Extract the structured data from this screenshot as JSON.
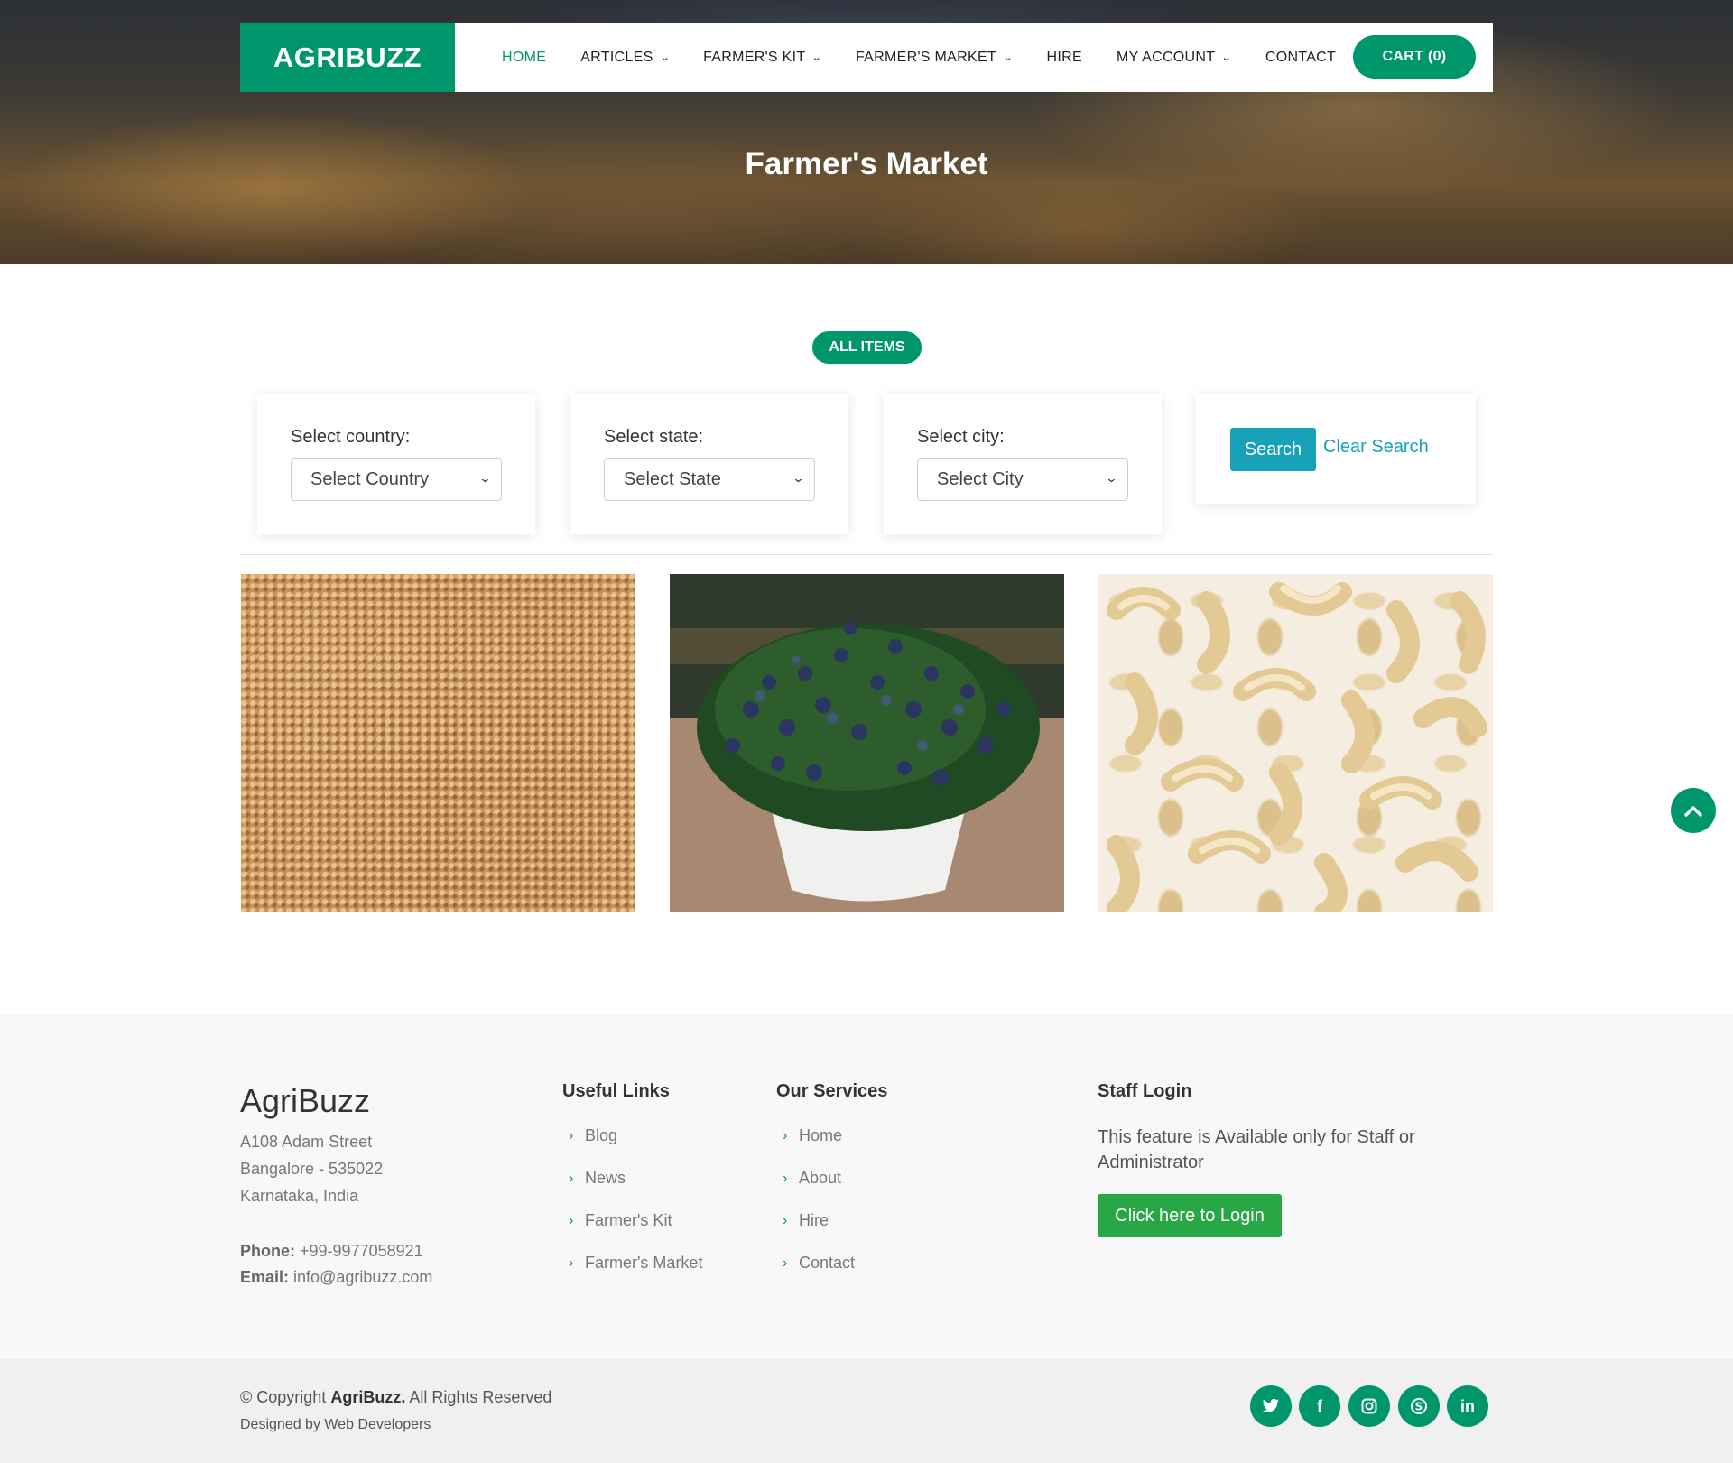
{
  "header": {
    "logo": "AGRIBUZZ",
    "nav": [
      {
        "label": "HOME",
        "active": true
      },
      {
        "label": "ARTICLES",
        "dropdown": true
      },
      {
        "label": "FARMER'S KIT",
        "dropdown": true
      },
      {
        "label": "FARMER'S MARKET",
        "dropdown": true
      },
      {
        "label": "HIRE"
      },
      {
        "label": "MY ACCOUNT",
        "dropdown": true
      },
      {
        "label": "CONTACT"
      }
    ],
    "cart_label": "CART (0)"
  },
  "hero": {
    "title": "Farmer's Market"
  },
  "filters": {
    "all_items": "ALL ITEMS",
    "country_label": "Select country:",
    "country_value": "Select Country",
    "state_label": "Select state:",
    "state_value": "Select State",
    "city_label": "Select city:",
    "city_value": "Select City",
    "search_label": "Search",
    "clear_label": "Clear Search"
  },
  "products": [
    {
      "name": "millet-image"
    },
    {
      "name": "blueberry-plant-image"
    },
    {
      "name": "cashew-image"
    }
  ],
  "footer": {
    "brand": "AgriBuzz",
    "address": [
      "A108 Adam Street",
      "Bangalore - 535022",
      "Karnataka, India"
    ],
    "phone_label": "Phone:",
    "phone": "+99-9977058921",
    "email_label": "Email:",
    "email": "info@agribuzz.com",
    "useful_links_title": "Useful Links",
    "useful_links": [
      "Blog",
      "News",
      "Farmer's Kit",
      "Farmer's Market"
    ],
    "services_title": "Our Services",
    "services": [
      "Home",
      "About",
      "Hire",
      "Contact"
    ],
    "staff_title": "Staff Login",
    "staff_text": "This feature is Available only for Staff or Administrator",
    "login_label": "Click here to Login",
    "copyright_prefix": "© Copyright",
    "copyright_brand": "AgriBuzz.",
    "copyright_suffix": "All Rights Reserved",
    "designed_by": "Designed by Web Developers"
  },
  "icons": {
    "social": [
      "twitter-icon",
      "facebook-icon",
      "instagram-icon",
      "skype-icon",
      "linkedin-icon"
    ],
    "to_top": "chevron-up-icon",
    "accent": "#00966b"
  }
}
